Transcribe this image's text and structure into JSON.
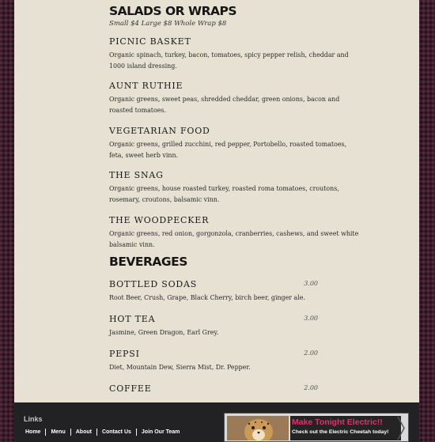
{
  "salads": {
    "title": "SALADS OR WRAPS",
    "subtitle": "Small $4 Large $8 Whole Wrap $8",
    "items": [
      {
        "name": "PICNIC BASKET",
        "desc": "Organic spinach, turkey, bacon, tomatoes, spicy pepper relish, cheddar and 1000 island dressing."
      },
      {
        "name": "AUNT RUTHIE",
        "desc": "Organic greens, sweet peas, shredded cheddar, green onions, bacon and roasted tomatoes."
      },
      {
        "name": "VEGETARIAN FOOD",
        "desc": "Organic greens, grilled zucchini, red pepper, Portobello, roasted tomatoes, feta, sweet herb vinn."
      },
      {
        "name": "THE SNAG",
        "desc": "Organic greens, house roasted turkey, roasted roma tomatoes, croutons, rosemary, croutons, balsamic vinn."
      },
      {
        "name": "THE WOODPECKER",
        "desc": "Organic greens, red onion, gorgonzola, cranberries, cashews, and sweet white balsamic vinn."
      }
    ]
  },
  "beverages": {
    "title": "BEVERAGES",
    "items": [
      {
        "name": "BOTTLED SODAS",
        "price": "3.00",
        "desc": "Root Beer, Crush, Grape, Black Cherry, birch beer, ginger ale."
      },
      {
        "name": "HOT TEA",
        "price": "3.00",
        "desc": "Jasmine, Green Dragon, Earl Grey."
      },
      {
        "name": "PEPSI",
        "price": "2.00",
        "desc": "Diet, Mountain Dew, Sierra Mist, Dr. Pepper."
      },
      {
        "name": "COFFEE",
        "price": "2.00"
      }
    ]
  },
  "footer": {
    "links_title": "Links",
    "links": [
      "Home",
      "Menu",
      "About",
      "Contact Us",
      "Join Our Team"
    ],
    "promo": {
      "title": "Make Tonight Electric!!",
      "subtitle": "Check out the Electric Cheetah today!"
    }
  },
  "colors": {
    "page_background": "#3a1f2c",
    "paper": "#e7e1d3",
    "footer_background": "#222224",
    "promo_title": "#e0316c"
  },
  "icons": {
    "promo_image": "cheetah-image",
    "promo_arrow": "chevron-right-icon"
  }
}
